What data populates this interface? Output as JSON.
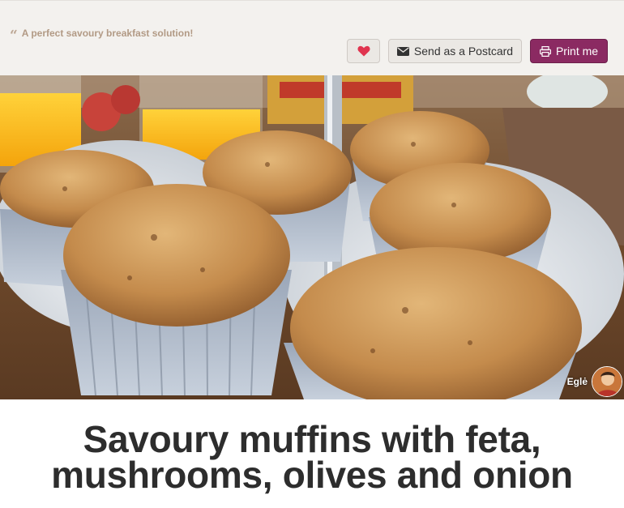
{
  "quote": {
    "icon": "quote-left-icon",
    "text": "A perfect savoury breakfast solution!"
  },
  "actions": {
    "favorite_icon": "heart-icon",
    "favorite_color": "#e0344f",
    "postcard_icon": "envelope-icon",
    "postcard_label": "Send as a Postcard",
    "print_icon": "printer-icon",
    "print_label": "Print me",
    "print_color": "#8b2a62"
  },
  "photo": {
    "author_name": "Eglė"
  },
  "recipe": {
    "title_line1": "Savoury muffins with feta,",
    "title_line2": "mushrooms, olives and onion"
  }
}
